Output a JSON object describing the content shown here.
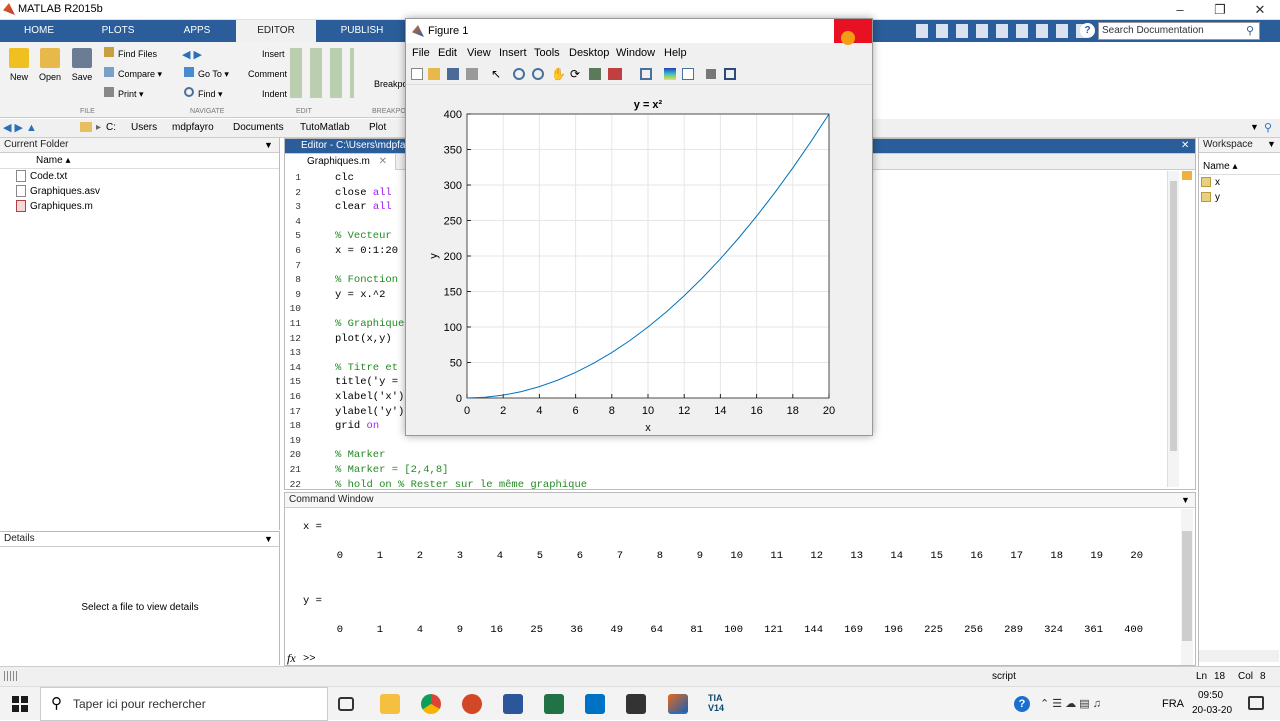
{
  "app": {
    "title": "MATLAB R2015b"
  },
  "ribbon_tabs": [
    "HOME",
    "PLOTS",
    "APPS",
    "EDITOR",
    "PUBLISH"
  ],
  "ribbon": {
    "new": "New",
    "open": "Open",
    "save": "Save",
    "find_files": "Find Files",
    "compare": "Compare",
    "print": "Print",
    "go_to": "Go To",
    "find": "Find",
    "insert": "Insert",
    "comment": "Comment",
    "indent": "Indent",
    "breakpoints": "Breakpo",
    "group_file": "FILE",
    "group_navigate": "NAVIGATE",
    "group_edit": "EDIT",
    "group_breakpoints": "BREAKPOI"
  },
  "search_doc": {
    "placeholder": "Search Documentation"
  },
  "address": {
    "crumbs": [
      "C:",
      "Users",
      "mdpfayro",
      "Documents",
      "TutoMatlab",
      "Plot"
    ]
  },
  "current_folder": {
    "title": "Current Folder",
    "col_name": "Name",
    "files": [
      "Code.txt",
      "Graphiques.asv",
      "Graphiques.m"
    ]
  },
  "details": {
    "title": "Details",
    "message": "Select a file to view details"
  },
  "editor": {
    "title": "Editor - C:\\Users\\mdpfa",
    "tab": "Graphiques.m",
    "lines": [
      {
        "n": "1",
        "text": "clc",
        "cls": ""
      },
      {
        "n": "2",
        "text": "close all",
        "cls": "kwtail"
      },
      {
        "n": "3",
        "text": "clear all",
        "cls": "kwtail"
      },
      {
        "n": "4",
        "text": "",
        "cls": ""
      },
      {
        "n": "5",
        "text": "% Vecteur",
        "cls": "cm"
      },
      {
        "n": "6",
        "text": "x = 0:1:20",
        "cls": ""
      },
      {
        "n": "7",
        "text": "",
        "cls": ""
      },
      {
        "n": "8",
        "text": "% Fonction",
        "cls": "cm"
      },
      {
        "n": "9",
        "text": "y = x.^2",
        "cls": ""
      },
      {
        "n": "10",
        "text": "",
        "cls": ""
      },
      {
        "n": "11",
        "text": "% Graphique",
        "cls": "cm"
      },
      {
        "n": "12",
        "text": "plot(x,y)",
        "cls": ""
      },
      {
        "n": "13",
        "text": "",
        "cls": ""
      },
      {
        "n": "14",
        "text": "% Titre et",
        "cls": "cm"
      },
      {
        "n": "15",
        "text": "title('y =",
        "cls": ""
      },
      {
        "n": "16",
        "text": "xlabel('x')",
        "cls": ""
      },
      {
        "n": "17",
        "text": "ylabel('y')",
        "cls": ""
      },
      {
        "n": "18",
        "text": "grid on",
        "cls": "kwtail"
      },
      {
        "n": "19",
        "text": "",
        "cls": ""
      },
      {
        "n": "20",
        "text": "% Marker",
        "cls": "cm"
      },
      {
        "n": "21",
        "text": "% Marker = [2,4,8]",
        "cls": "cm"
      },
      {
        "n": "22",
        "text": "% hold on % Rester sur le même graphique",
        "cls": "cm"
      }
    ]
  },
  "command_window": {
    "title": "Command Window",
    "x_label": "x =",
    "x_values": [
      "0",
      "1",
      "2",
      "3",
      "4",
      "5",
      "6",
      "7",
      "8",
      "9",
      "10",
      "11",
      "12",
      "13",
      "14",
      "15",
      "16",
      "17",
      "18",
      "19",
      "20"
    ],
    "y_label": "y =",
    "y_values": [
      "0",
      "1",
      "4",
      "9",
      "16",
      "25",
      "36",
      "49",
      "64",
      "81",
      "100",
      "121",
      "144",
      "169",
      "196",
      "225",
      "256",
      "289",
      "324",
      "361",
      "400"
    ],
    "prompt": ">>",
    "fx": "fx"
  },
  "workspace": {
    "title": "Workspace",
    "col_name": "Name",
    "vars": [
      "x",
      "y"
    ]
  },
  "status": {
    "script": "script",
    "ln": "Ln",
    "ln_val": "18",
    "col": "Col",
    "col_val": "8"
  },
  "figure": {
    "title": "Figure 1",
    "menu": [
      "File",
      "Edit",
      "View",
      "Insert",
      "Tools",
      "Desktop",
      "Window",
      "Help"
    ]
  },
  "chart_data": {
    "type": "line",
    "title": "y = x²",
    "xlabel": "x",
    "ylabel": "y",
    "xlim": [
      0,
      20
    ],
    "ylim": [
      0,
      400
    ],
    "xticks": [
      0,
      2,
      4,
      6,
      8,
      10,
      12,
      14,
      16,
      18,
      20
    ],
    "yticks": [
      0,
      50,
      100,
      150,
      200,
      250,
      300,
      350,
      400
    ],
    "grid": true,
    "series": [
      {
        "color": "#0072bd",
        "x": [
          0,
          1,
          2,
          3,
          4,
          5,
          6,
          7,
          8,
          9,
          10,
          11,
          12,
          13,
          14,
          15,
          16,
          17,
          18,
          19,
          20
        ],
        "y": [
          0,
          1,
          4,
          9,
          16,
          25,
          36,
          49,
          64,
          81,
          100,
          121,
          144,
          169,
          196,
          225,
          256,
          289,
          324,
          361,
          400
        ]
      }
    ]
  },
  "taskbar": {
    "search_placeholder": "Taper ici pour rechercher",
    "lang": "FRA",
    "time": "09:50",
    "date": "20-03-20",
    "tia": "TIA\nV14"
  },
  "colors": {
    "tabbar": "#2a5d9a",
    "close": "#e81123",
    "line": "#0072bd"
  }
}
